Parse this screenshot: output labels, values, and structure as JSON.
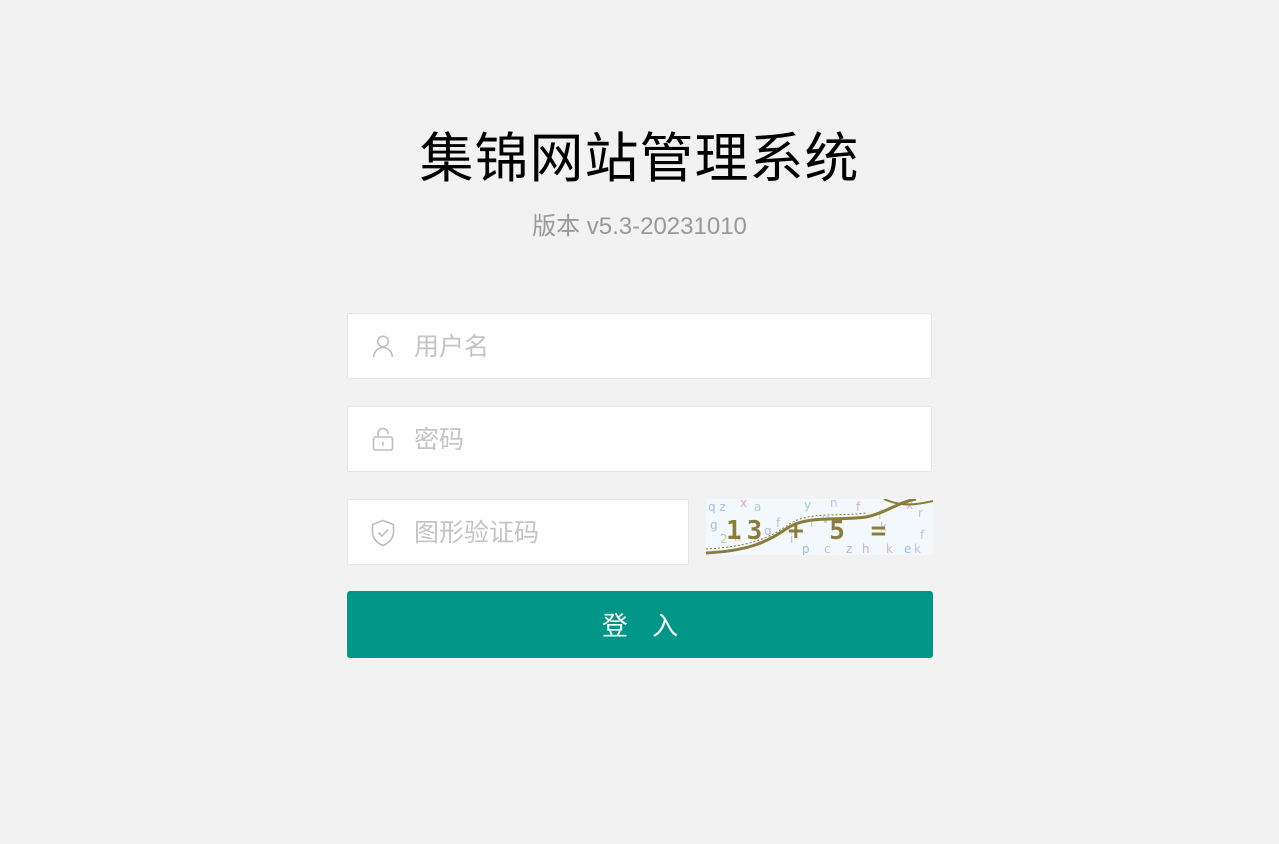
{
  "header": {
    "title": "集锦网站管理系统",
    "version": "版本 v5.3-20231010"
  },
  "form": {
    "username": {
      "value": "",
      "placeholder": "用户名",
      "icon": "user-icon"
    },
    "password": {
      "value": "",
      "placeholder": "密码",
      "icon": "lock-icon"
    },
    "captcha": {
      "value": "",
      "placeholder": "图形验证码",
      "icon": "shield-icon"
    },
    "captcha_image": {
      "expression": "13 + 5 ="
    },
    "submit_label": "登 入"
  },
  "colors": {
    "background": "#f2f2f2",
    "primary": "#009688",
    "placeholder": "#c4c4c4",
    "version_text": "#999999"
  }
}
